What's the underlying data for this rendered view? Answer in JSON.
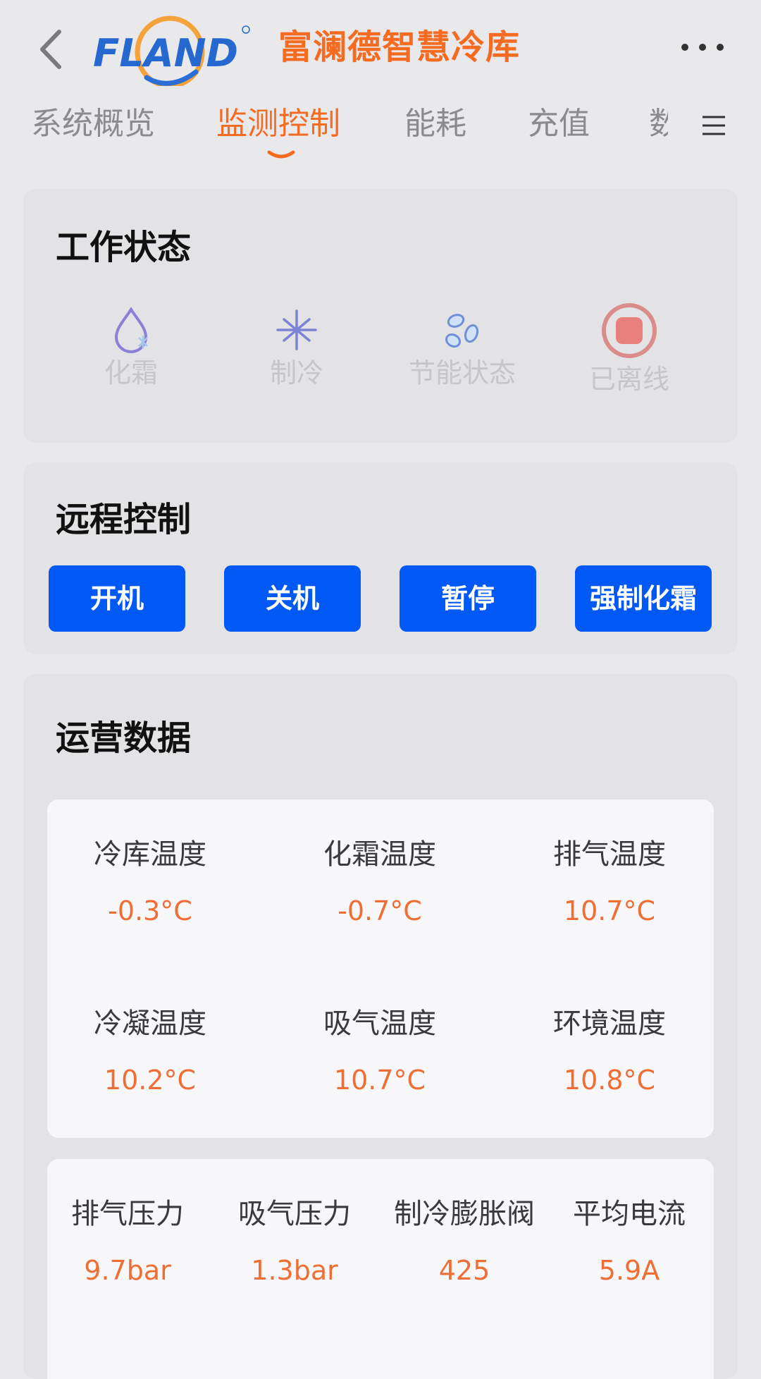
{
  "header": {
    "logo_text": "FLAND",
    "title": "富澜德智慧冷库",
    "back_icon": "chevron-left-icon",
    "more_icon": "more-horizontal-icon"
  },
  "tabs": {
    "items": [
      {
        "label": "系统概览",
        "active": false
      },
      {
        "label": "监测控制",
        "active": true
      },
      {
        "label": "能耗",
        "active": false
      },
      {
        "label": "充值",
        "active": false
      },
      {
        "label": "数",
        "active": false
      }
    ],
    "menu_icon": "menu-icon"
  },
  "work_status": {
    "title": "工作状态",
    "items": [
      {
        "label": "化霜",
        "icon": "defrost-drop-icon"
      },
      {
        "label": "制冷",
        "icon": "snowflake-icon"
      },
      {
        "label": "节能状态",
        "icon": "leaves-icon"
      },
      {
        "label": "已离线",
        "icon": "offline-stop-icon"
      }
    ]
  },
  "remote_control": {
    "title": "远程控制",
    "buttons": [
      {
        "label": "开机"
      },
      {
        "label": "关机"
      },
      {
        "label": "暂停"
      },
      {
        "label": "强制化霜"
      }
    ]
  },
  "operation_data": {
    "title": "运营数据",
    "temperatures": [
      {
        "label": "冷库温度",
        "value": "-0.3°C"
      },
      {
        "label": "化霜温度",
        "value": "-0.7°C"
      },
      {
        "label": "排气温度",
        "value": "10.7°C"
      },
      {
        "label": "冷凝温度",
        "value": "10.2°C"
      },
      {
        "label": "吸气温度",
        "value": "10.7°C"
      },
      {
        "label": "环境温度",
        "value": "10.8°C"
      }
    ],
    "metrics": [
      {
        "label": "排气压力",
        "value": "9.7bar"
      },
      {
        "label": "吸气压力",
        "value": "1.3bar"
      },
      {
        "label": "制冷膨胀阀",
        "value": "425"
      },
      {
        "label": "平均电流",
        "value": "5.9A"
      }
    ]
  },
  "colors": {
    "accent": "#f46b21",
    "button_blue": "#0058f5",
    "value_orange": "#ee6e34",
    "offline_red": "#e8817c"
  }
}
